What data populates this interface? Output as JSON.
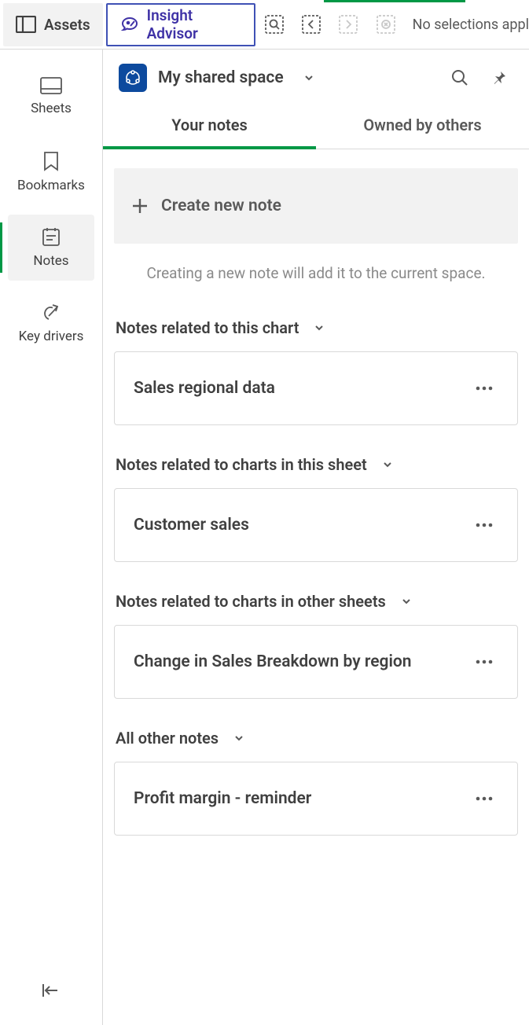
{
  "topbar": {
    "assets_label": "Assets",
    "advisor_label": "Insight Advisor",
    "selections_text": "No selections appl"
  },
  "sidebar": {
    "items": [
      {
        "label": "Sheets"
      },
      {
        "label": "Bookmarks"
      },
      {
        "label": "Notes"
      },
      {
        "label": "Key drivers"
      }
    ]
  },
  "panel": {
    "space_name": "My shared space",
    "tabs": [
      {
        "label": "Your notes"
      },
      {
        "label": "Owned by others"
      }
    ],
    "create_label": "Create new note",
    "hint": "Creating a new note will add it to the current space.",
    "sections": [
      {
        "heading": "Notes related to this chart",
        "note": "Sales regional data"
      },
      {
        "heading": "Notes related to charts in this sheet",
        "note": "Customer sales"
      },
      {
        "heading": "Notes related to charts in other sheets",
        "note": "Change in Sales Breakdown by region"
      },
      {
        "heading": "All other notes",
        "note": "Profit margin - reminder"
      }
    ]
  }
}
